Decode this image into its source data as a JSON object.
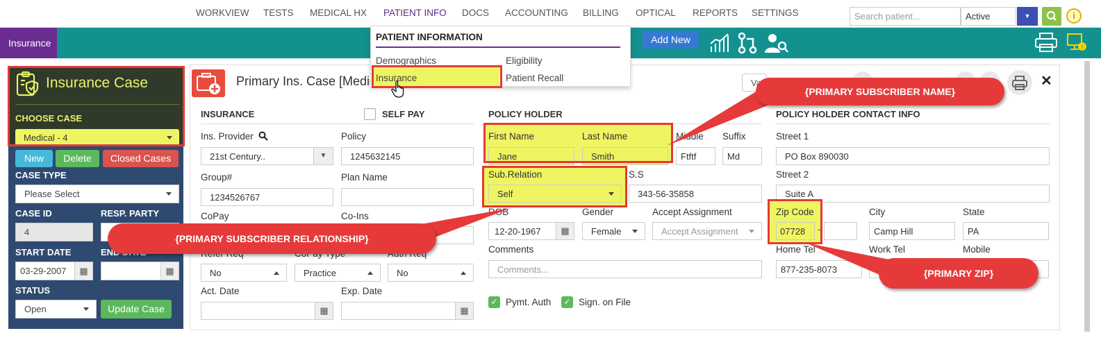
{
  "nav": {
    "items": [
      "WORKVIEW",
      "TESTS",
      "MEDICAL HX",
      "PATIENT INFO",
      "DOCS",
      "ACCOUNTING",
      "BILLING",
      "OPTICAL",
      "REPORTS",
      "SETTINGS"
    ],
    "active": "PATIENT INFO",
    "search_placeholder": "Search patient...",
    "status_value": "Active"
  },
  "toolbar": {
    "section_label": "Insurance",
    "add_new_label": "Add New"
  },
  "menu": {
    "header": "PATIENT INFORMATION",
    "items": [
      "Demographics",
      "Eligibility",
      "Insurance",
      "Patient Recall"
    ]
  },
  "left_panel": {
    "title": "Insurance Case",
    "choose_case_label": "CHOOSE CASE",
    "case_value": "Medical - 4",
    "new_label": "New",
    "delete_label": "Delete",
    "closed_cases_label": "Closed Cases",
    "case_type_label": "CASE TYPE",
    "case_type_value": "Please Select",
    "case_id_label": "CASE ID",
    "case_id_value": "4",
    "resp_party_label": "RESP. PARTY",
    "start_date_label": "START DATE",
    "start_date_value": "03-29-2007",
    "end_date_label": "END DATE",
    "status_label": "STATUS",
    "status_value": "Open",
    "update_case_label": "Update Case"
  },
  "main": {
    "title": "Primary Ins. Case [Medic",
    "v_button": "Va",
    "insurance_section": "INSURANCE",
    "self_pay_label": "SELF PAY",
    "ins_provider_label": "Ins. Provider",
    "ins_provider_value": "21st Century..",
    "policy_label": "Policy",
    "policy_value": "1245632145",
    "group_label": "Group#",
    "group_value": "1234526767",
    "plan_name_label": "Plan Name",
    "copay_label": "CoPay",
    "coins_label": "Co-Ins",
    "refer_req_label": "Refer Req",
    "refer_req_value": "No",
    "copay_type_label": "CoPay Type",
    "copay_type_value": "Practice",
    "auth_req_label": "Auth Req",
    "auth_req_value": "No",
    "act_date_label": "Act. Date",
    "exp_date_label": "Exp. Date",
    "policy_holder_section": "POLICY HOLDER",
    "first_name_label": "First Name",
    "first_name_value": "Jane",
    "last_name_label": "Last Name",
    "last_name_value": "Smith",
    "middle_label": "Middle",
    "middle_value": "Ftftf",
    "suffix_label": "Suffix",
    "suffix_value": "Md",
    "sub_relation_label": "Sub.Relation",
    "sub_relation_value": "Self",
    "ss_label": "S.S",
    "ss_value": "343-56-35858",
    "dob_label": "DOB",
    "dob_value": "12-20-1967",
    "gender_label": "Gender",
    "gender_value": "Female",
    "accept_assignment_label": "Accept Assignment",
    "accept_assignment_placeholder": "Accept Assignment",
    "comments_label": "Comments",
    "comments_placeholder": "Comments...",
    "pymt_auth_label": "Pymt. Auth",
    "sign_on_file_label": "Sign. on File",
    "contact_section": "POLICY HOLDER CONTACT INFO",
    "street1_label": "Street 1",
    "street1_value": "PO Box 890030",
    "street2_label": "Street 2",
    "street2_value": "Suite A",
    "zip_label": "Zip Code",
    "zip_value": "07728",
    "city_label": "City",
    "city_value": "Camp Hill",
    "state_label": "State",
    "state_value": "PA",
    "home_tel_label": "Home Tel",
    "home_tel_value": "877-235-8073",
    "work_tel_label": "Work Tel",
    "mobile_label": "Mobile"
  },
  "callouts": {
    "name": "{PRIMARY SUBSCRIBER NAME}",
    "relationship": "{PRIMARY SUBSCRIBER RELATIONSHIP}",
    "zip": "{PRIMARY ZIP}"
  }
}
